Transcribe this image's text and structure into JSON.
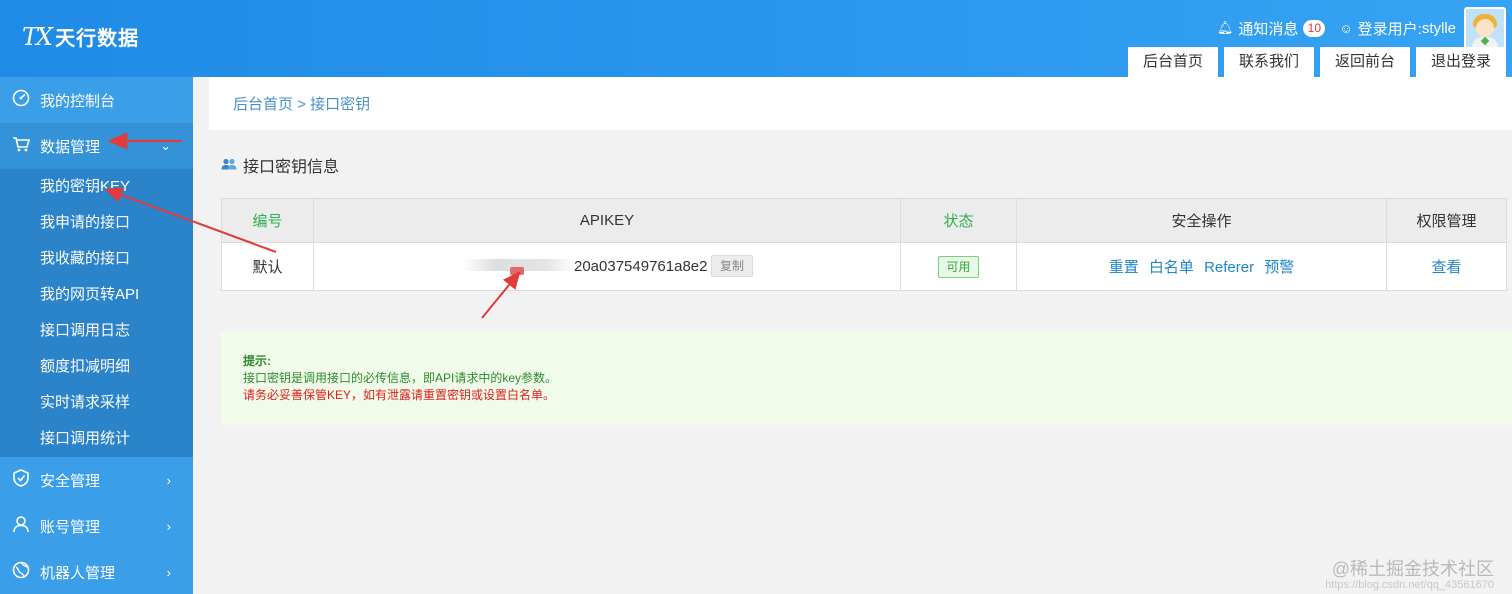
{
  "header": {
    "logo_mark": "TX",
    "logo_text": "天行数据",
    "notice_label": "通知消息",
    "notice_count": "10",
    "login_label": "登录用户:",
    "username": "stylle",
    "nav": [
      "后台首页",
      "联系我们",
      "返回前台",
      "退出登录"
    ]
  },
  "sidebar": {
    "items": [
      {
        "label": "我的控制台",
        "icon": "dashboard-icon"
      },
      {
        "label": "数据管理",
        "icon": "cart-icon",
        "open": true
      },
      {
        "label": "安全管理",
        "icon": "shield-icon"
      },
      {
        "label": "账号管理",
        "icon": "user-icon"
      },
      {
        "label": "机器人管理",
        "icon": "robot-icon"
      }
    ],
    "submenu": [
      "我的密钥KEY",
      "我申请的接口",
      "我收藏的接口",
      "我的网页转API",
      "接口调用日志",
      "额度扣减明细",
      "实时请求采样",
      "接口调用统计"
    ]
  },
  "breadcrumb": "后台首页 > 接口密钥",
  "section_title": "接口密钥信息",
  "table": {
    "headers": [
      "编号",
      "APIKEY",
      "状态",
      "安全操作",
      "权限管理"
    ],
    "row": {
      "id": "默认",
      "apikey_visible": "20a037549761a8e2",
      "copy_label": "复制",
      "status": "可用",
      "actions": [
        "重置",
        "白名单",
        "Referer",
        "预警"
      ],
      "permission": "查看"
    }
  },
  "tips": {
    "title": "提示:",
    "line1": "接口密钥是调用接口的必传信息，即API请求中的key参数。",
    "line2": "请务必妥善保管KEY，如有泄露请重置密钥或设置白名单。"
  },
  "watermark": {
    "main": "@稀土掘金技术社区",
    "url": "https://blog.csdn.net/qq_43561670"
  },
  "colors": {
    "header_blue": "#1f8be6",
    "sidebar_blue": "#3a9ee8",
    "submenu_blue": "#2b83c9",
    "link_blue": "#1f86c9",
    "header_green": "#2eb050",
    "tip_red": "#e02020",
    "annotation_red": "#e23b3b"
  }
}
